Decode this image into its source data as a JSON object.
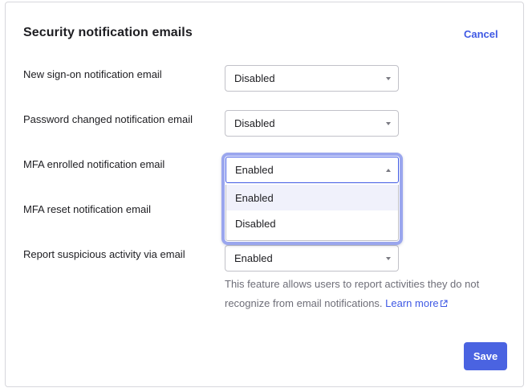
{
  "panel": {
    "title": "Security notification emails",
    "cancel_label": "Cancel",
    "save_label": "Save"
  },
  "rows": [
    {
      "label": "New sign-on notification email",
      "value": "Disabled"
    },
    {
      "label": "Password changed notification email",
      "value": "Disabled"
    },
    {
      "label": "MFA enrolled notification email",
      "value": "Enabled"
    },
    {
      "label": "MFA reset notification email",
      "value": ""
    },
    {
      "label": "Report suspicious activity via email",
      "value": "Enabled"
    }
  ],
  "dropdown": {
    "options": [
      "Enabled",
      "Disabled"
    ],
    "highlighted": "Enabled"
  },
  "help": {
    "text": "This feature allows users to report activities they do not recognize from email notifications.",
    "link_label": "Learn more"
  },
  "icons": {
    "caret": "chevron-down-icon",
    "caret_open": "chevron-up-icon",
    "external": "external-link-icon"
  },
  "colors": {
    "accent": "#3f59e4",
    "focus_ring": "#9aa6ee",
    "save_button": "#4a63e1"
  }
}
